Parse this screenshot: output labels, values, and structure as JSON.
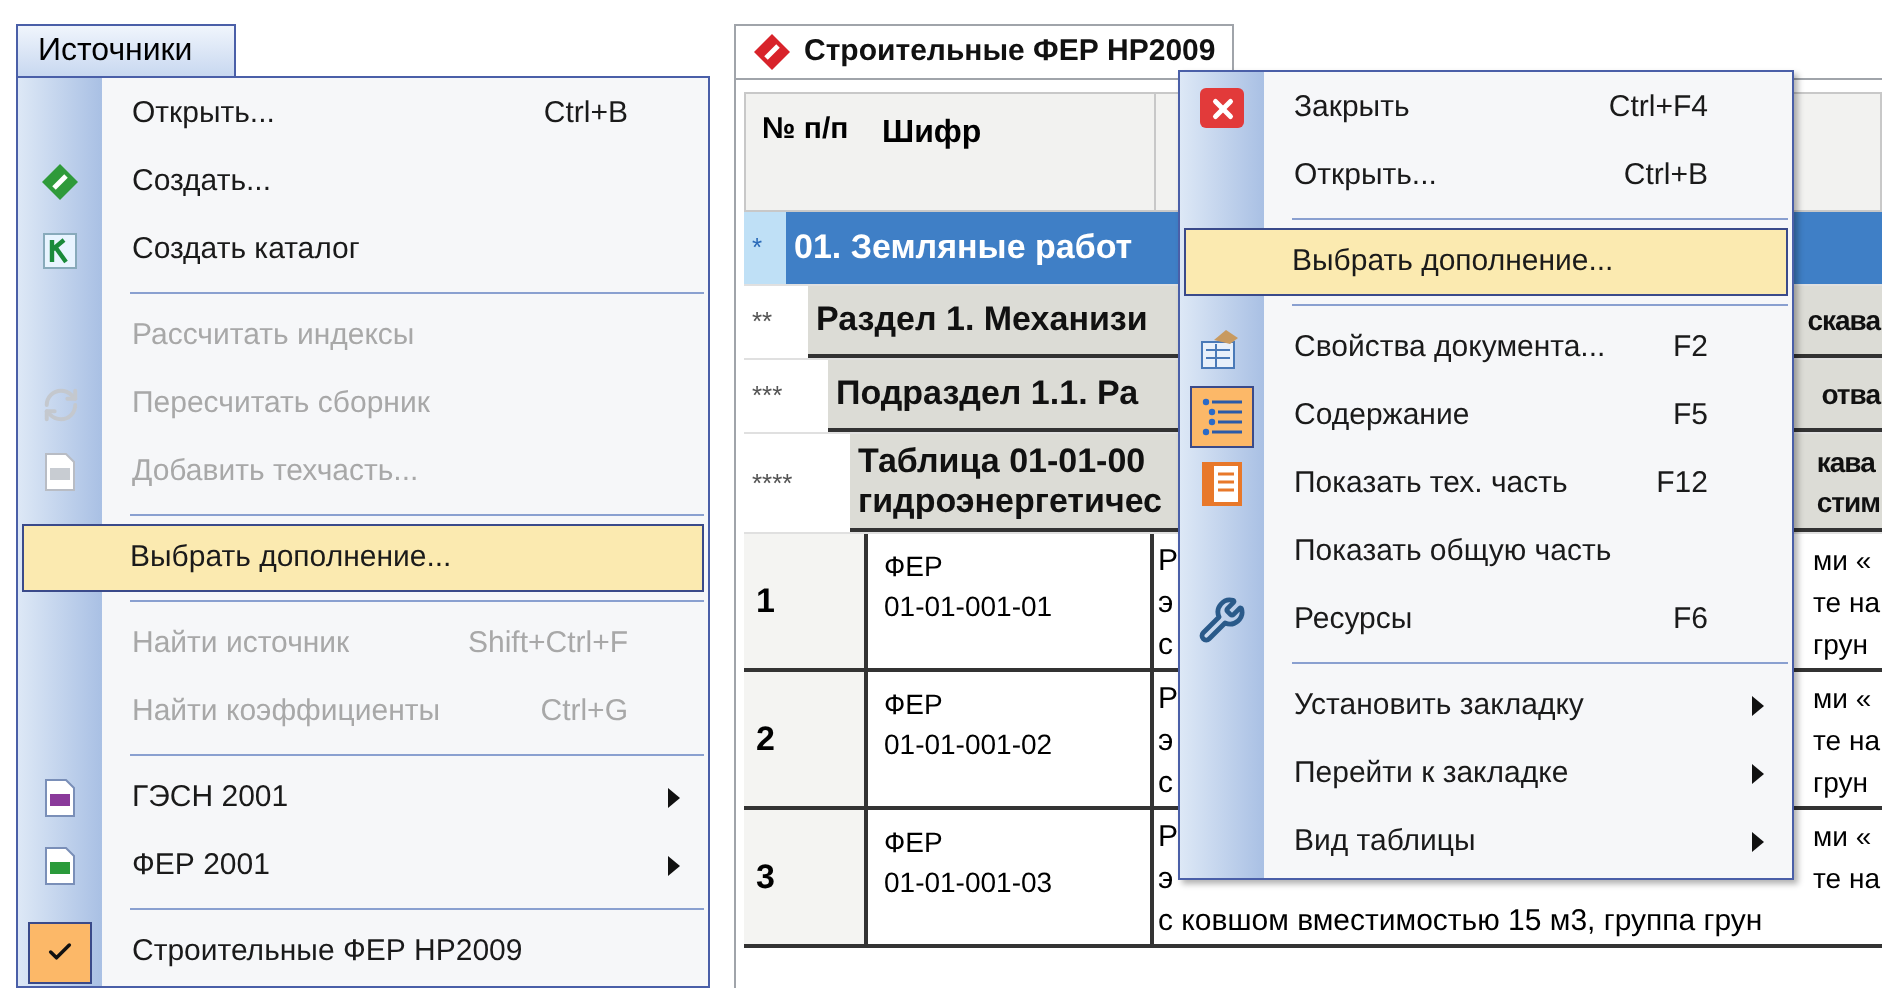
{
  "menu_bar": {
    "title": "Источники",
    "selected": true
  },
  "source_menu": [
    {
      "kind": "item",
      "label": "Открыть...",
      "shortcut": "Ctrl+B",
      "disabled": false,
      "highlighted": false,
      "checked": false,
      "submenu": false
    },
    {
      "kind": "item",
      "label": "Создать...",
      "disabled": false,
      "highlighted": false,
      "checked": false,
      "submenu": false
    },
    {
      "kind": "item",
      "label": "Создать каталог",
      "disabled": false,
      "highlighted": false,
      "checked": false,
      "submenu": false
    },
    {
      "kind": "separator"
    },
    {
      "kind": "item",
      "label": "Рассчитать индексы",
      "disabled": true,
      "highlighted": false,
      "checked": false,
      "submenu": false
    },
    {
      "kind": "item",
      "label": "Пересчитать сборник",
      "disabled": true,
      "highlighted": false,
      "checked": false,
      "submenu": false
    },
    {
      "kind": "item",
      "label": "Добавить техчасть...",
      "disabled": true,
      "highlighted": false,
      "checked": false,
      "submenu": false
    },
    {
      "kind": "separator"
    },
    {
      "kind": "item",
      "label": "Выбрать дополнение...",
      "disabled": false,
      "highlighted": true,
      "checked": false,
      "submenu": false
    },
    {
      "kind": "separator"
    },
    {
      "kind": "item",
      "label": "Найти источник",
      "shortcut": "Shift+Ctrl+F",
      "disabled": true,
      "highlighted": false,
      "checked": false,
      "submenu": false
    },
    {
      "kind": "item",
      "label": "Найти коэффициенты",
      "shortcut": "Ctrl+G",
      "disabled": true,
      "highlighted": false,
      "checked": false,
      "submenu": false
    },
    {
      "kind": "separator"
    },
    {
      "kind": "item",
      "label": "ГЭСН 2001",
      "disabled": false,
      "highlighted": false,
      "checked": false,
      "submenu": true
    },
    {
      "kind": "item",
      "label": "ФЕР 2001",
      "disabled": false,
      "highlighted": false,
      "checked": false,
      "submenu": true
    },
    {
      "kind": "separator"
    },
    {
      "kind": "item",
      "label": "Строительные ФЕР НР2009",
      "disabled": false,
      "highlighted": false,
      "checked": true,
      "submenu": false
    }
  ],
  "document_window": {
    "title": "Строительные ФЕР НР2009",
    "table": {
      "columns": [
        "№ п/п",
        "Шифр"
      ],
      "group_rows": [
        {
          "marker": "*",
          "lines": [
            "01. Земляные работ"
          ],
          "right_lines": [],
          "selected": true
        },
        {
          "marker": "**",
          "lines": [
            "Раздел 1. Механизи"
          ],
          "right_lines": [
            "скава"
          ],
          "selected": false
        },
        {
          "marker": "***",
          "lines": [
            "Подраздел 1.1. Ра"
          ],
          "right_lines": [
            "отва"
          ],
          "selected": false
        },
        {
          "marker": "****",
          "lines": [
            "Таблица 01-01-00",
            "гидроэнергетичес"
          ],
          "right_lines": [
            "кава",
            "стим"
          ],
          "selected": false
        }
      ],
      "rows": [
        {
          "number": "1",
          "code_prefix": "ФЕР",
          "code": "01-01-001-01",
          "column_3_left": [
            "Р",
            "э",
            "с"
          ],
          "column_3_right": [
            "ми «",
            "те на",
            "грун"
          ]
        },
        {
          "number": "2",
          "code_prefix": "ФЕР",
          "code": "01-01-001-02",
          "column_3_left": [
            "Р",
            "э",
            "с"
          ],
          "column_3_right": [
            "ми «",
            "те на",
            "грун"
          ]
        },
        {
          "number": "3",
          "code_prefix": "ФЕР",
          "code": "01-01-001-03",
          "column_3_left": [
            "Р",
            "э"
          ],
          "column_3_right": [
            "ми «",
            "те на"
          ],
          "column_3_last_line": "с ковшом вместимостью 15 м3, группа грун"
        }
      ]
    }
  },
  "context_menu": [
    {
      "kind": "item",
      "label": "Закрыть",
      "shortcut": "Ctrl+F4",
      "highlighted": false,
      "checked": false,
      "submenu": false
    },
    {
      "kind": "item",
      "label": "Открыть...",
      "shortcut": "Ctrl+B",
      "highlighted": false,
      "checked": false,
      "submenu": false
    },
    {
      "kind": "separator"
    },
    {
      "kind": "item",
      "label": "Выбрать дополнение...",
      "highlighted": true,
      "checked": false,
      "submenu": false
    },
    {
      "kind": "separator"
    },
    {
      "kind": "item",
      "label": "Свойства документа...",
      "shortcut": "F2",
      "highlighted": false,
      "checked": false,
      "submenu": false
    },
    {
      "kind": "item",
      "label": "Содержание",
      "shortcut": "F5",
      "highlighted": false,
      "checked": true,
      "submenu": false
    },
    {
      "kind": "item",
      "label": "Показать тех. часть",
      "shortcut": "F12",
      "highlighted": false,
      "checked": false,
      "submenu": false
    },
    {
      "kind": "item",
      "label": "Показать общую часть",
      "highlighted": false,
      "checked": false,
      "submenu": false
    },
    {
      "kind": "item",
      "label": "Ресурсы",
      "shortcut": "F6",
      "highlighted": false,
      "checked": false,
      "submenu": false
    },
    {
      "kind": "separator"
    },
    {
      "kind": "item",
      "label": "Установить закладку",
      "highlighted": false,
      "checked": false,
      "submenu": true
    },
    {
      "kind": "item",
      "label": "Перейти к закладке",
      "highlighted": false,
      "checked": false,
      "submenu": true
    },
    {
      "kind": "item",
      "label": "Вид таблицы",
      "highlighted": false,
      "checked": false,
      "submenu": true
    }
  ]
}
